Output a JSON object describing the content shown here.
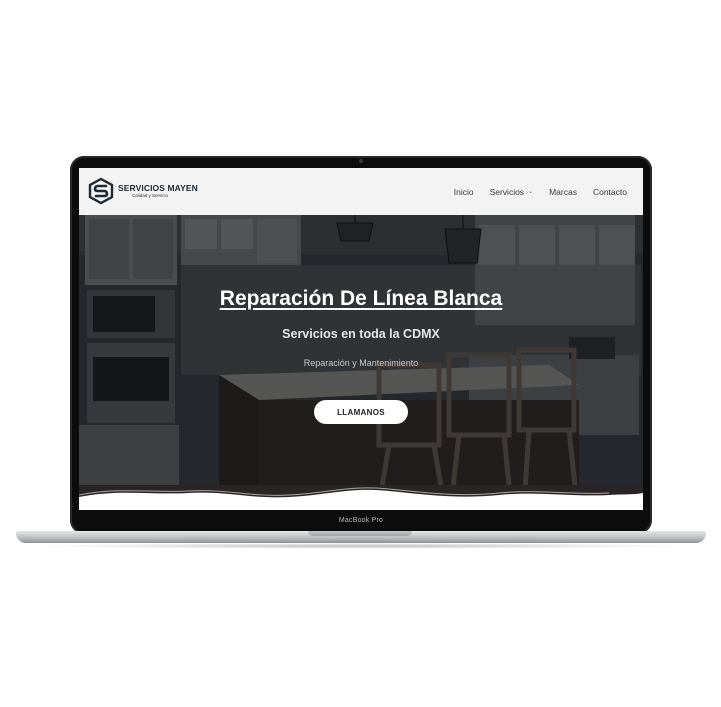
{
  "device": {
    "label": "MacBook Pro"
  },
  "header": {
    "logo": {
      "name": "SERVICIOS MAYEN",
      "tagline": "Calidad y Servicio"
    },
    "nav": [
      {
        "label": "Inicio"
      },
      {
        "label": "Servicios",
        "icon": "chevron-down-icon"
      },
      {
        "label": "Marcas"
      },
      {
        "label": "Contacto"
      }
    ]
  },
  "hero": {
    "title": "Reparación De Línea Blanca",
    "subtitle": "Servicios en toda la CDMX",
    "tagline": "Reparación y Mantenimiento",
    "cta": "LLAMANOS"
  },
  "colors": {
    "header_bg": "#f3f3f3",
    "hero_overlay": "#1c1f23",
    "cta_bg": "#ffffff",
    "logo_dark": "#1f2a33"
  }
}
